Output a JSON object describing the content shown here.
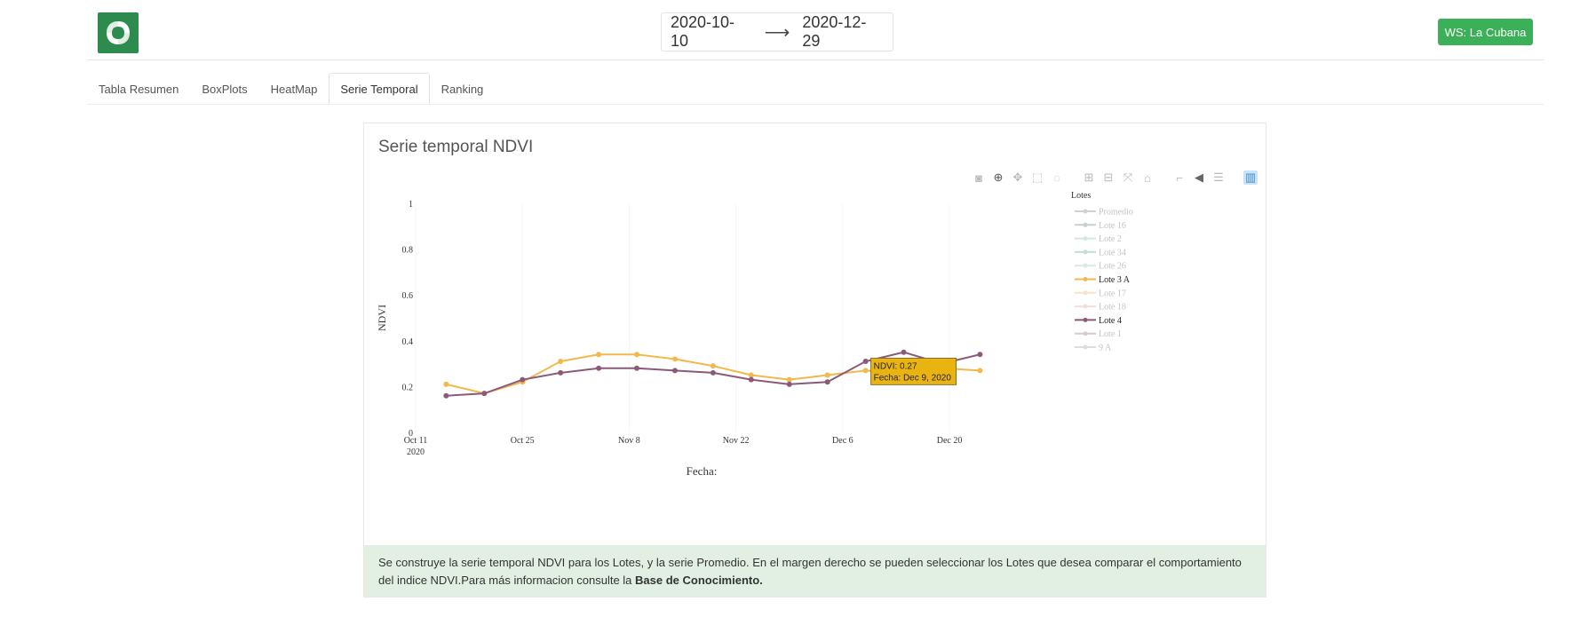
{
  "header": {
    "date_start": "2020-10-10",
    "date_arrow": "⟶",
    "date_end": "2020-12-29",
    "ws_label": "WS: La Cubana"
  },
  "tabs": [
    {
      "label": "Tabla Resumen",
      "active": false
    },
    {
      "label": "BoxPlots",
      "active": false
    },
    {
      "label": "HeatMap",
      "active": false
    },
    {
      "label": "Serie Temporal",
      "active": true
    },
    {
      "label": "Ranking",
      "active": false
    }
  ],
  "card": {
    "title": "Serie temporal NDVI"
  },
  "modebar": [
    "camera-icon",
    "zoom-icon",
    "pan-icon",
    "box-select-icon",
    "lasso-icon",
    "zoom-in-icon",
    "zoom-out-icon",
    "autoscale-icon",
    "home-icon",
    "spike-lines-icon",
    "hover-closest-icon",
    "hover-compare-icon",
    "plotly-logo-icon"
  ],
  "colors": {
    "brand": "#2e8b4e",
    "lote3a": "#f2b84b",
    "lote4": "#8b5a7b",
    "tooltip_bg": "#e9b412"
  },
  "chart_data": {
    "type": "line",
    "title": "",
    "xlabel": "Fecha:",
    "ylabel": "NDVI",
    "ylim": [
      0,
      1
    ],
    "y_ticks": [
      "0",
      "0.2",
      "0.4",
      "0.6",
      "0.8",
      "1"
    ],
    "x_ticks": [
      {
        "date": "2020-10-11",
        "label": "Oct 11",
        "sublabel": "2020"
      },
      {
        "date": "2020-10-25",
        "label": "Oct 25",
        "sublabel": ""
      },
      {
        "date": "2020-11-08",
        "label": "Nov 8",
        "sublabel": ""
      },
      {
        "date": "2020-11-22",
        "label": "Nov 22",
        "sublabel": ""
      },
      {
        "date": "2020-12-06",
        "label": "Dec 6",
        "sublabel": ""
      },
      {
        "date": "2020-12-20",
        "label": "Dec 20",
        "sublabel": ""
      }
    ],
    "x_range": [
      "2020-10-11",
      "2020-12-25"
    ],
    "legend_title": "Lotes",
    "legend_position": "right",
    "legend": [
      {
        "name": "Promedio",
        "color": "#9a9a9a",
        "visible": false
      },
      {
        "name": "Lote 16",
        "color": "#7f9f9a",
        "visible": false
      },
      {
        "name": "Lote 2",
        "color": "#9ccfb2",
        "visible": false
      },
      {
        "name": "Lote 34",
        "color": "#7fb5a5",
        "visible": false
      },
      {
        "name": "Lote 26",
        "color": "#a7d3b9",
        "visible": false
      },
      {
        "name": "Lote 3 A",
        "color": "#f2b84b",
        "visible": true
      },
      {
        "name": "Lote 17",
        "color": "#f0c28a",
        "visible": false
      },
      {
        "name": "Lote 18",
        "color": "#e7b5ad",
        "visible": false
      },
      {
        "name": "Lote 4",
        "color": "#8b5a7b",
        "visible": true
      },
      {
        "name": "Lote 1",
        "color": "#a58ca0",
        "visible": false
      },
      {
        "name": "9 A",
        "color": "#b5b5b5",
        "visible": false
      }
    ],
    "series": [
      {
        "name": "Lote 3 A",
        "color": "#f2b84b",
        "x": [
          "2020-10-15",
          "2020-10-20",
          "2020-10-25",
          "2020-10-30",
          "2020-11-04",
          "2020-11-09",
          "2020-11-14",
          "2020-11-19",
          "2020-11-24",
          "2020-11-29",
          "2020-12-04",
          "2020-12-09",
          "2020-12-14",
          "2020-12-19",
          "2020-12-24"
        ],
        "y": [
          0.21,
          0.17,
          0.22,
          0.31,
          0.34,
          0.34,
          0.32,
          0.29,
          0.25,
          0.23,
          0.25,
          0.27,
          0.26,
          0.28,
          0.27
        ]
      },
      {
        "name": "Lote 4",
        "color": "#8b5a7b",
        "x": [
          "2020-10-15",
          "2020-10-20",
          "2020-10-25",
          "2020-10-30",
          "2020-11-04",
          "2020-11-09",
          "2020-11-14",
          "2020-11-19",
          "2020-11-24",
          "2020-11-29",
          "2020-12-04",
          "2020-12-09",
          "2020-12-14",
          "2020-12-19",
          "2020-12-24"
        ],
        "y": [
          0.16,
          0.17,
          0.23,
          0.26,
          0.28,
          0.28,
          0.27,
          0.26,
          0.23,
          0.21,
          0.22,
          0.31,
          0.35,
          0.3,
          0.34
        ]
      }
    ],
    "tooltip": {
      "line1": "NDVI: 0.27",
      "line2": "Fecha: Dec 9, 2020",
      "x": "2020-12-09",
      "y": 0.27
    }
  },
  "info": {
    "text": "Se construye la serie temporal NDVI para los Lotes, y la serie Promedio. En el margen derecho se pueden seleccionar los Lotes que desea comparar el comportamiento del indice NDVI.Para más informacion consulte la ",
    "link": "Base de Conocimiento."
  }
}
